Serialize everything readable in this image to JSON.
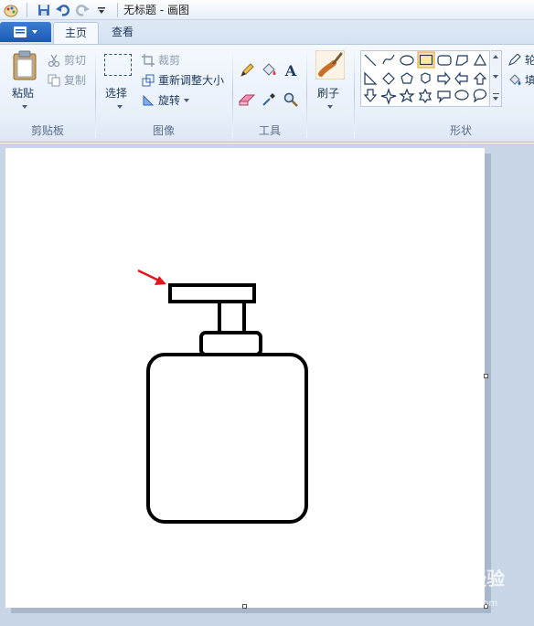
{
  "window": {
    "title": "无标题 - 画图"
  },
  "tabs": [
    {
      "label": "主页",
      "active": true
    },
    {
      "label": "查看",
      "active": false
    }
  ],
  "ribbon": {
    "clipboard": {
      "group_label": "剪贴板",
      "paste_label": "粘贴",
      "cut_label": "剪切",
      "copy_label": "复制"
    },
    "image": {
      "group_label": "图像",
      "select_label": "选择",
      "crop_label": "裁剪",
      "resize_label": "重新调整大小",
      "rotate_label": "旋转"
    },
    "tools": {
      "group_label": "工具",
      "icons": [
        "pencil-icon",
        "fill-bucket-icon",
        "text-icon",
        "eraser-icon",
        "color-picker-icon",
        "magnifier-icon"
      ]
    },
    "brushes": {
      "label": "刷子"
    },
    "shapes": {
      "group_label": "形状",
      "outline_label": "轮",
      "fill_label": "填",
      "selected_shape": "rectangle"
    }
  },
  "colors": {
    "accent": "#1b58b8",
    "ribbon_bg": "#f5f9fe",
    "workspace_bg": "#c8d5e6",
    "arrow": "#e8141b"
  },
  "watermark": {
    "text": "Baidu经验",
    "sub": "jingyan.baidu.com"
  }
}
